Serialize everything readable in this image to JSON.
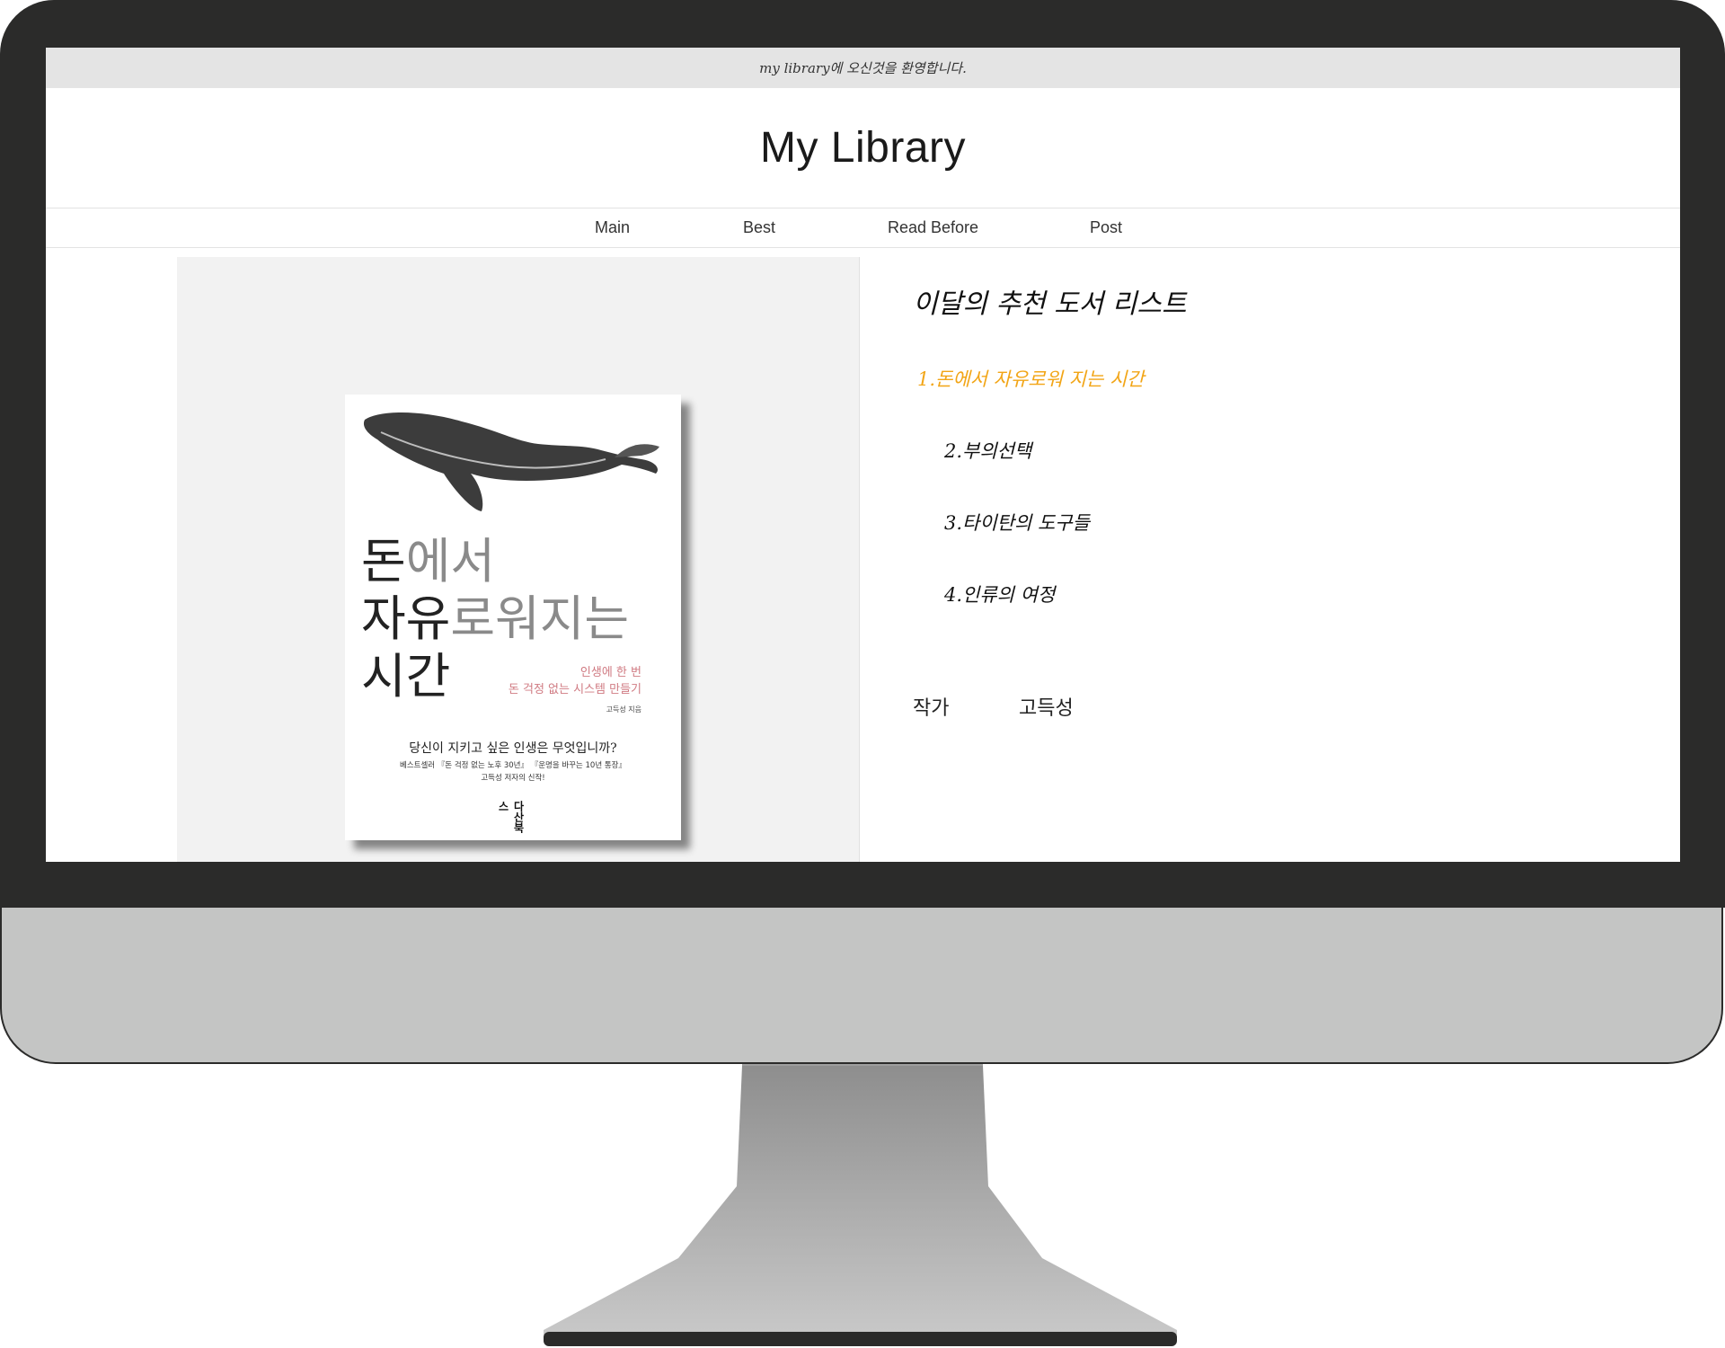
{
  "screen": {
    "welcome_text": "my library에 오신것을 환영합니다.",
    "site_title": "My Library",
    "nav": [
      {
        "label": "Main"
      },
      {
        "label": "Best"
      },
      {
        "label": "Read Before"
      },
      {
        "label": "Post"
      }
    ],
    "cover": {
      "title_line1_dark": "돈",
      "title_line1_light": "에서",
      "title_line2_dark": "자유",
      "title_line2_light": "로워지는",
      "title_line3_dark": "시간",
      "subtitle_line1": "인생에 한 번",
      "subtitle_line2": "돈 걱정 없는 시스템 만들기",
      "author": "고득성 지음",
      "tagline": "당신이 지키고 싶은 인생은 무엇입니까?",
      "desc_line1": "베스트셀러 『돈 걱정 없는 노후 30년』 『운명을 바꾸는 10년 통장』",
      "desc_line2": "고득성 저자의 신작!",
      "publisher_logo": "다산북스",
      "image_icon": "whale-illustration-icon"
    },
    "list": {
      "heading": "이달의 추천 도서 리스트",
      "items": [
        {
          "label": "1.돈에서 자유로워 지는 시간",
          "active": true
        },
        {
          "label": "2.부의선택",
          "active": false
        },
        {
          "label": "3.타이탄의 도구들",
          "active": false
        },
        {
          "label": "4.인류의 여정",
          "active": false
        }
      ],
      "author_label": "작가",
      "author_value": "고득성"
    }
  },
  "colors": {
    "bezel": "#2b2b2a",
    "chin": "#c4c5c4",
    "topbar": "#e4e4e4",
    "active_item": "#f2a516",
    "cover_panel": "#f2f2f2"
  }
}
